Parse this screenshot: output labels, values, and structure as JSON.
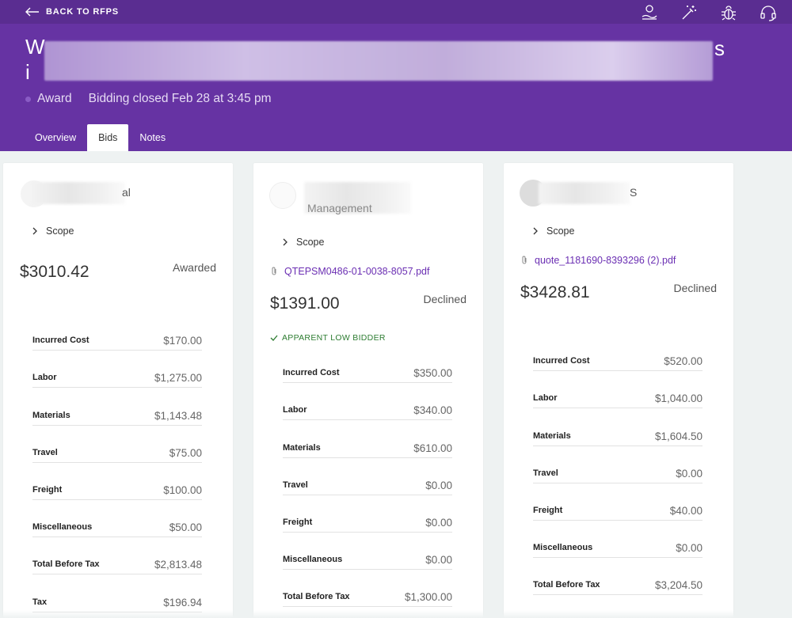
{
  "topbar": {
    "back_label": "BACK TO RFPS",
    "icons": [
      "hand-coin-icon",
      "magic-wand-icon",
      "bug-icon",
      "headset-icon"
    ]
  },
  "header": {
    "title_start_1": "W",
    "title_start_2": "i",
    "title_end": "s",
    "status_label": "Award",
    "bidding_label": "Bidding closed Feb 28 at 3:45 pm"
  },
  "tabs": [
    {
      "label": "Overview",
      "active": false
    },
    {
      "label": "Bids",
      "active": true
    },
    {
      "label": "Notes",
      "active": false
    }
  ],
  "bids": [
    {
      "vendor_suffix": "al",
      "scope_label": "Scope",
      "attachment": null,
      "price": "$3010.42",
      "status": "Awarded",
      "low_bidder": null,
      "costs": [
        {
          "label": "Incurred Cost",
          "value": "$170.00"
        },
        {
          "label": "Labor",
          "value": "$1,275.00"
        },
        {
          "label": "Materials",
          "value": "$1,143.48"
        },
        {
          "label": "Travel",
          "value": "$75.00"
        },
        {
          "label": "Freight",
          "value": "$100.00"
        },
        {
          "label": "Miscellaneous",
          "value": "$50.00"
        },
        {
          "label": "Total Before Tax",
          "value": "$2,813.48"
        },
        {
          "label": "Tax",
          "value": "$196.94"
        }
      ]
    },
    {
      "vendor_suffix": "Management",
      "scope_label": "Scope",
      "attachment": "QTEPSM0486-01-0038-8057.pdf",
      "price": "$1391.00",
      "status": "Declined",
      "low_bidder": "APPARENT LOW BIDDER",
      "costs": [
        {
          "label": "Incurred Cost",
          "value": "$350.00"
        },
        {
          "label": "Labor",
          "value": "$340.00"
        },
        {
          "label": "Materials",
          "value": "$610.00"
        },
        {
          "label": "Travel",
          "value": "$0.00"
        },
        {
          "label": "Freight",
          "value": "$0.00"
        },
        {
          "label": "Miscellaneous",
          "value": "$0.00"
        },
        {
          "label": "Total Before Tax",
          "value": "$1,300.00"
        }
      ]
    },
    {
      "vendor_suffix": "S",
      "scope_label": "Scope",
      "attachment": "quote_1181690-8393296 (2).pdf",
      "price": "$3428.81",
      "status": "Declined",
      "low_bidder": null,
      "costs": [
        {
          "label": "Incurred Cost",
          "value": "$520.00"
        },
        {
          "label": "Labor",
          "value": "$1,040.00"
        },
        {
          "label": "Materials",
          "value": "$1,604.50"
        },
        {
          "label": "Travel",
          "value": "$0.00"
        },
        {
          "label": "Freight",
          "value": "$40.00"
        },
        {
          "label": "Miscellaneous",
          "value": "$0.00"
        },
        {
          "label": "Total Before Tax",
          "value": "$3,204.50"
        }
      ]
    }
  ],
  "colors": {
    "topbar": "#5a2d91",
    "header": "#6633a3",
    "link": "#6b2fb3",
    "success": "#2e7d32",
    "background": "#eef2f2"
  }
}
